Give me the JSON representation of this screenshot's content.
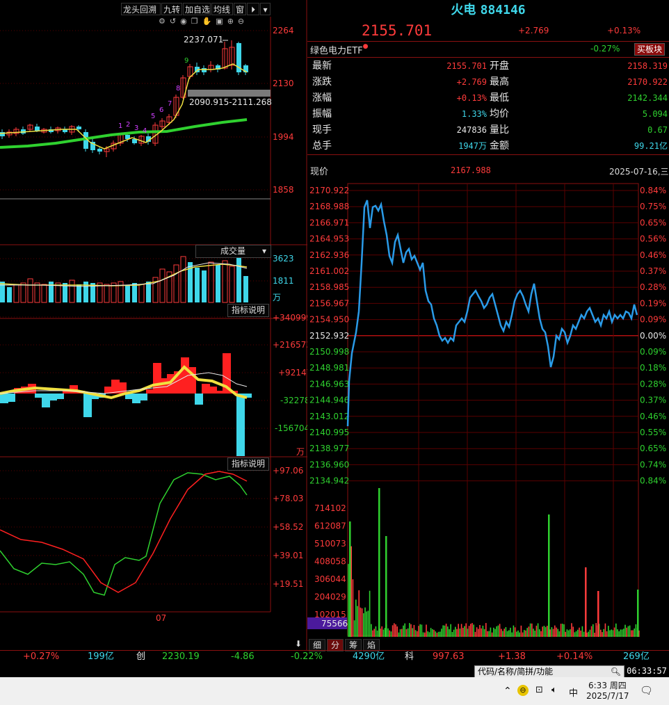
{
  "toolbar": {
    "buttons": [
      "龙头回溯",
      "九转",
      "加自选",
      "均线",
      "窗"
    ],
    "icons": [
      "gear-icon",
      "undo-icon",
      "eye-icon",
      "copy-icon",
      "hand-icon",
      "lock-icon",
      "zoom-in-icon",
      "zoom-out-icon"
    ]
  },
  "kline": {
    "yticks": [
      "2264",
      "2130",
      "1994",
      "1858"
    ],
    "high_label": "2237.071",
    "range_label": "2090.915-2111.268",
    "nine_turn": [
      "1",
      "2",
      "3",
      "4",
      "5",
      "6",
      "7",
      "8",
      "9"
    ],
    "bottom_date": "07"
  },
  "volume_panel": {
    "title": "成交量",
    "yticks": [
      "3623",
      "1811"
    ],
    "unit": "万"
  },
  "macd_panel": {
    "help": "指标说明",
    "yticks": [
      "+340999",
      "+216573",
      "+92147",
      "-32278",
      "-156704"
    ],
    "unit": "万"
  },
  "kdj_panel": {
    "help": "指标说明",
    "yticks": [
      "+97.06",
      "+78.03",
      "+58.52",
      "+39.01",
      "+19.51"
    ]
  },
  "stock": {
    "name": "火电",
    "code": "884146",
    "price": "2155.701",
    "change": "+2.769",
    "change_pct": "+0.13%",
    "etf_name": "绿色电力ETF",
    "etf_pct": "-0.27%",
    "sector_button": "买板块",
    "rows": [
      {
        "l1": "最新",
        "v1": "2155.701",
        "c1": "red",
        "l2": "开盘",
        "v2": "2158.319",
        "c2": "red"
      },
      {
        "l1": "涨跌",
        "v1": "+2.769",
        "c1": "red",
        "l2": "最高",
        "v2": "2170.922",
        "c2": "red"
      },
      {
        "l1": "涨幅",
        "v1": "+0.13%",
        "c1": "red",
        "l2": "最低",
        "v2": "2142.344",
        "c2": "green"
      },
      {
        "l1": "振幅",
        "v1": "1.33%",
        "c1": "cyan",
        "l2": "均价",
        "v2": "5.094",
        "c2": "green"
      },
      {
        "l1": "现手",
        "v1": "247836",
        "c1": "white",
        "l2": "量比",
        "v2": "0.67",
        "c2": "green"
      },
      {
        "l1": "总手",
        "v1": "1947万",
        "c1": "cyan",
        "l2": "金额",
        "v2": "99.21亿",
        "c2": "cyan"
      }
    ]
  },
  "intraday": {
    "label": "现价",
    "current": "2167.988",
    "date": "2025-07-16,三",
    "price_ticks": [
      "2170.922",
      "2168.988",
      "2166.971",
      "2164.953",
      "2162.936",
      "2161.002",
      "2158.985",
      "2156.967",
      "2154.950",
      "2152.932",
      "2150.998",
      "2148.981",
      "2146.963",
      "2144.946",
      "2143.012",
      "2140.995",
      "2138.977",
      "2136.960",
      "2134.942"
    ],
    "pct_ticks": [
      "0.84%",
      "0.75%",
      "0.65%",
      "0.56%",
      "0.46%",
      "0.37%",
      "0.28%",
      "0.19%",
      "0.09%",
      "0.00%",
      "0.09%",
      "0.18%",
      "0.28%",
      "0.37%",
      "0.46%",
      "0.55%",
      "0.65%",
      "0.74%",
      "0.84%"
    ],
    "vol_ticks": [
      "714102",
      "612087",
      "510073",
      "408058",
      "306044",
      "204029",
      "102015"
    ],
    "vol_last": "75566",
    "tabs": [
      "细",
      "分",
      "筹",
      "焰"
    ]
  },
  "ticker": [
    {
      "text": "+0.27%",
      "color": "red"
    },
    {
      "text": "199亿",
      "color": "cyan"
    },
    {
      "text": "创",
      "color": "white"
    },
    {
      "text": "2230.19",
      "color": "green"
    },
    {
      "text": "-4.86",
      "color": "green"
    },
    {
      "text": "-0.22%",
      "color": "green"
    },
    {
      "text": "4290亿",
      "color": "cyan"
    },
    {
      "text": "科",
      "color": "white"
    },
    {
      "text": "997.63",
      "color": "red"
    },
    {
      "text": "+1.38",
      "color": "red"
    },
    {
      "text": "+0.14%",
      "color": "red"
    },
    {
      "text": "269亿",
      "color": "cyan"
    }
  ],
  "search": {
    "placeholder": "代码/名称/简拼/功能"
  },
  "clock": "06:33:57",
  "taskbar": {
    "time": "6:33 周四",
    "date": "2025/7/17",
    "ime": "中"
  },
  "colors": {
    "up": "#ff3b3b",
    "down": "#3fd7ea",
    "price_line": "#2a9be8",
    "grid": "#5a0000",
    "bg": "#000000"
  }
}
